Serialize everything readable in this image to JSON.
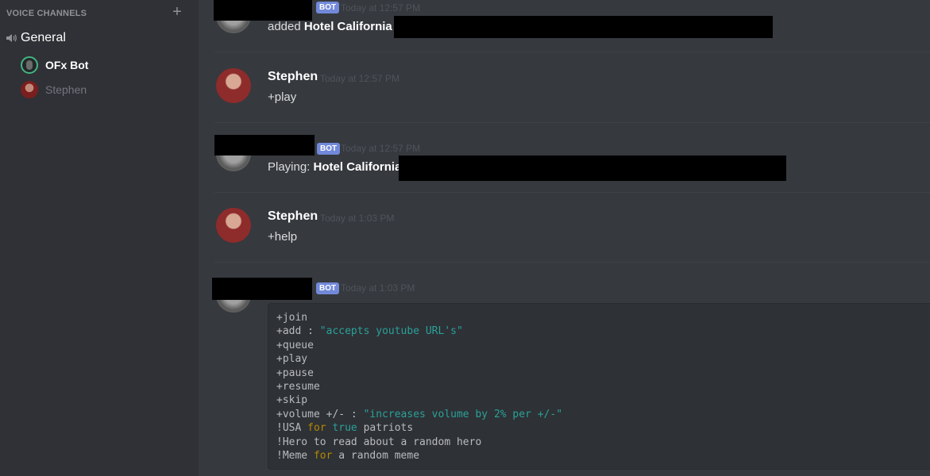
{
  "sidebar": {
    "voice_header": "VOICE CHANNELS",
    "add_symbol": "+",
    "channel_name": "General",
    "users": [
      {
        "name": "OFx Bot"
      },
      {
        "name": "Stephen"
      }
    ]
  },
  "messages": [
    {
      "badge": "BOT",
      "timestamp": "Today at 12:57 PM",
      "prefix": "added ",
      "bold": "Hotel California"
    },
    {
      "username": "Stephen",
      "timestamp": "Today at 12:57 PM",
      "text": "+play"
    },
    {
      "badge": "BOT",
      "timestamp": "Today at 12:57 PM",
      "prefix": "Playing: ",
      "bold": "Hotel California"
    },
    {
      "username": "Stephen",
      "timestamp": "Today at 1:03 PM",
      "text": "+help"
    },
    {
      "badge": "BOT",
      "timestamp": "Today at 1:03 PM"
    }
  ],
  "help_code": {
    "join": "+join",
    "add_cmd": "+add : ",
    "add_str": "\"accepts youtube URL's\"",
    "queue": "+queue",
    "play": "+play",
    "pause": "+pause",
    "resume": "+resume",
    "skip": "+skip",
    "volume_cmd": "+volume +/- : ",
    "volume_str": "\"increases volume by 2% per +/-\"",
    "usa_a": "!USA ",
    "usa_for": "for",
    "usa_sp": " ",
    "usa_true": "true",
    "usa_b": " patriots",
    "hero": "!Hero to read about a random hero",
    "meme_a": "!Meme ",
    "meme_for": "for",
    "meme_b": " a random meme"
  },
  "colors": {
    "accent_bot_badge": "#7289da",
    "online": "#43b581",
    "code_string": "#2aa198",
    "code_keyword": "#b58900"
  }
}
